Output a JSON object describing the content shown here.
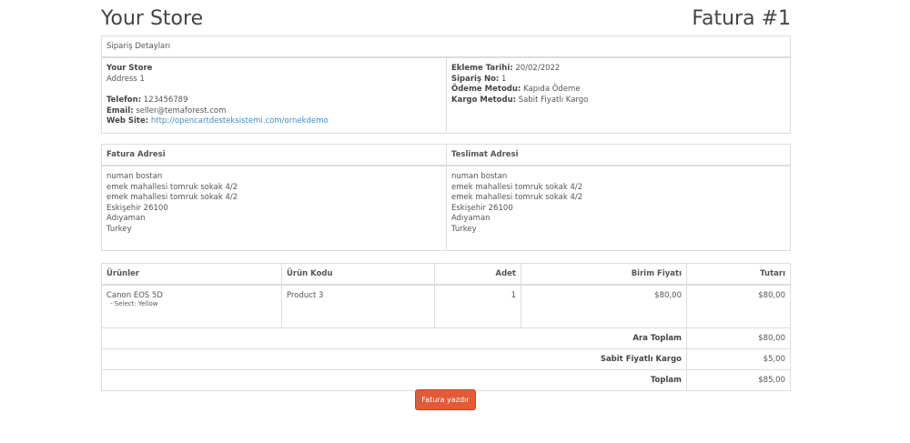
{
  "header": {
    "store_name": "Your Store",
    "invoice_title": "Fatura #1"
  },
  "order_details": {
    "heading": "Sipariş Detayları",
    "store": {
      "name": "Your Store",
      "address": "Address 1",
      "phone_label": "Telefon:",
      "phone": "123456789",
      "email_label": "Email:",
      "email": "seller@temaforest.com",
      "website_label": "Web Site:",
      "website": "http://opencartdesteksistemi.com/ornekdemo"
    },
    "meta": {
      "date_label": "Ekleme Tarihi:",
      "date": "20/02/2022",
      "order_no_label": "Sipariş No:",
      "order_no": "1",
      "payment_label": "Ödeme Metodu:",
      "payment": "Kapıda Ödeme",
      "shipping_label": "Kargo Metodu:",
      "shipping": "Sabit Fiyatlı Kargo"
    }
  },
  "addresses": {
    "billing_heading": "Fatura Adresi",
    "shipping_heading": "Teslimat Adresi",
    "billing_lines": [
      "numan bostan",
      "emek mahallesi tomruk sokak 4/2",
      "emek mahallesi tomruk sokak 4/2",
      "Eskişehir 26100",
      "Adıyaman",
      "Turkey"
    ],
    "shipping_lines": [
      "numan bostan",
      "emek mahallesi tomruk sokak 4/2",
      "emek mahallesi tomruk sokak 4/2",
      "Eskişehir 26100",
      "Adıyaman",
      "Turkey"
    ]
  },
  "products": {
    "columns": [
      "Ürünler",
      "Ürün Kodu",
      "Adet",
      "Birim Fiyatı",
      "Tutarı"
    ],
    "rows": [
      {
        "name": "Canon EOS 5D",
        "option": "- Select: Yellow",
        "code": "Product 3",
        "qty": "1",
        "unit_price": "$80,00",
        "total": "$80,00"
      }
    ],
    "totals": [
      {
        "label": "Ara Toplam",
        "value": "$80,00"
      },
      {
        "label": "Sabit Fiyatlı Kargo",
        "value": "$5,00"
      },
      {
        "label": "Toplam",
        "value": "$85,00"
      }
    ]
  },
  "print_button": {
    "label": "Fatura yazdır"
  },
  "colors": {
    "button": "#e25b36",
    "link": "#3b8fc6",
    "border": "#dddddd"
  }
}
